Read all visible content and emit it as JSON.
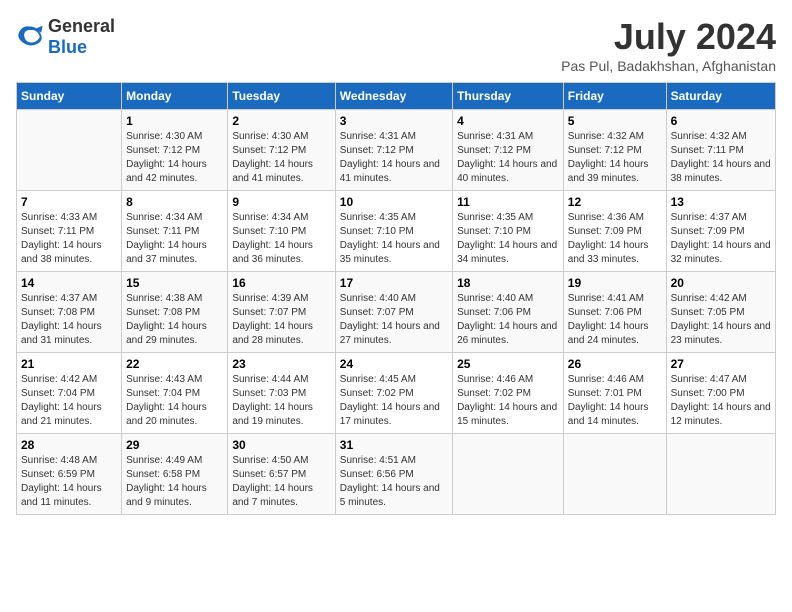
{
  "logo": {
    "general": "General",
    "blue": "Blue"
  },
  "title": "July 2024",
  "subtitle": "Pas Pul, Badakhshan, Afghanistan",
  "days_of_week": [
    "Sunday",
    "Monday",
    "Tuesday",
    "Wednesday",
    "Thursday",
    "Friday",
    "Saturday"
  ],
  "weeks": [
    [
      {
        "day": "",
        "sunrise": "",
        "sunset": "",
        "daylight": ""
      },
      {
        "day": "1",
        "sunrise": "Sunrise: 4:30 AM",
        "sunset": "Sunset: 7:12 PM",
        "daylight": "Daylight: 14 hours and 42 minutes."
      },
      {
        "day": "2",
        "sunrise": "Sunrise: 4:30 AM",
        "sunset": "Sunset: 7:12 PM",
        "daylight": "Daylight: 14 hours and 41 minutes."
      },
      {
        "day": "3",
        "sunrise": "Sunrise: 4:31 AM",
        "sunset": "Sunset: 7:12 PM",
        "daylight": "Daylight: 14 hours and 41 minutes."
      },
      {
        "day": "4",
        "sunrise": "Sunrise: 4:31 AM",
        "sunset": "Sunset: 7:12 PM",
        "daylight": "Daylight: 14 hours and 40 minutes."
      },
      {
        "day": "5",
        "sunrise": "Sunrise: 4:32 AM",
        "sunset": "Sunset: 7:12 PM",
        "daylight": "Daylight: 14 hours and 39 minutes."
      },
      {
        "day": "6",
        "sunrise": "Sunrise: 4:32 AM",
        "sunset": "Sunset: 7:11 PM",
        "daylight": "Daylight: 14 hours and 38 minutes."
      }
    ],
    [
      {
        "day": "7",
        "sunrise": "Sunrise: 4:33 AM",
        "sunset": "Sunset: 7:11 PM",
        "daylight": "Daylight: 14 hours and 38 minutes."
      },
      {
        "day": "8",
        "sunrise": "Sunrise: 4:34 AM",
        "sunset": "Sunset: 7:11 PM",
        "daylight": "Daylight: 14 hours and 37 minutes."
      },
      {
        "day": "9",
        "sunrise": "Sunrise: 4:34 AM",
        "sunset": "Sunset: 7:10 PM",
        "daylight": "Daylight: 14 hours and 36 minutes."
      },
      {
        "day": "10",
        "sunrise": "Sunrise: 4:35 AM",
        "sunset": "Sunset: 7:10 PM",
        "daylight": "Daylight: 14 hours and 35 minutes."
      },
      {
        "day": "11",
        "sunrise": "Sunrise: 4:35 AM",
        "sunset": "Sunset: 7:10 PM",
        "daylight": "Daylight: 14 hours and 34 minutes."
      },
      {
        "day": "12",
        "sunrise": "Sunrise: 4:36 AM",
        "sunset": "Sunset: 7:09 PM",
        "daylight": "Daylight: 14 hours and 33 minutes."
      },
      {
        "day": "13",
        "sunrise": "Sunrise: 4:37 AM",
        "sunset": "Sunset: 7:09 PM",
        "daylight": "Daylight: 14 hours and 32 minutes."
      }
    ],
    [
      {
        "day": "14",
        "sunrise": "Sunrise: 4:37 AM",
        "sunset": "Sunset: 7:08 PM",
        "daylight": "Daylight: 14 hours and 31 minutes."
      },
      {
        "day": "15",
        "sunrise": "Sunrise: 4:38 AM",
        "sunset": "Sunset: 7:08 PM",
        "daylight": "Daylight: 14 hours and 29 minutes."
      },
      {
        "day": "16",
        "sunrise": "Sunrise: 4:39 AM",
        "sunset": "Sunset: 7:07 PM",
        "daylight": "Daylight: 14 hours and 28 minutes."
      },
      {
        "day": "17",
        "sunrise": "Sunrise: 4:40 AM",
        "sunset": "Sunset: 7:07 PM",
        "daylight": "Daylight: 14 hours and 27 minutes."
      },
      {
        "day": "18",
        "sunrise": "Sunrise: 4:40 AM",
        "sunset": "Sunset: 7:06 PM",
        "daylight": "Daylight: 14 hours and 26 minutes."
      },
      {
        "day": "19",
        "sunrise": "Sunrise: 4:41 AM",
        "sunset": "Sunset: 7:06 PM",
        "daylight": "Daylight: 14 hours and 24 minutes."
      },
      {
        "day": "20",
        "sunrise": "Sunrise: 4:42 AM",
        "sunset": "Sunset: 7:05 PM",
        "daylight": "Daylight: 14 hours and 23 minutes."
      }
    ],
    [
      {
        "day": "21",
        "sunrise": "Sunrise: 4:42 AM",
        "sunset": "Sunset: 7:04 PM",
        "daylight": "Daylight: 14 hours and 21 minutes."
      },
      {
        "day": "22",
        "sunrise": "Sunrise: 4:43 AM",
        "sunset": "Sunset: 7:04 PM",
        "daylight": "Daylight: 14 hours and 20 minutes."
      },
      {
        "day": "23",
        "sunrise": "Sunrise: 4:44 AM",
        "sunset": "Sunset: 7:03 PM",
        "daylight": "Daylight: 14 hours and 19 minutes."
      },
      {
        "day": "24",
        "sunrise": "Sunrise: 4:45 AM",
        "sunset": "Sunset: 7:02 PM",
        "daylight": "Daylight: 14 hours and 17 minutes."
      },
      {
        "day": "25",
        "sunrise": "Sunrise: 4:46 AM",
        "sunset": "Sunset: 7:02 PM",
        "daylight": "Daylight: 14 hours and 15 minutes."
      },
      {
        "day": "26",
        "sunrise": "Sunrise: 4:46 AM",
        "sunset": "Sunset: 7:01 PM",
        "daylight": "Daylight: 14 hours and 14 minutes."
      },
      {
        "day": "27",
        "sunrise": "Sunrise: 4:47 AM",
        "sunset": "Sunset: 7:00 PM",
        "daylight": "Daylight: 14 hours and 12 minutes."
      }
    ],
    [
      {
        "day": "28",
        "sunrise": "Sunrise: 4:48 AM",
        "sunset": "Sunset: 6:59 PM",
        "daylight": "Daylight: 14 hours and 11 minutes."
      },
      {
        "day": "29",
        "sunrise": "Sunrise: 4:49 AM",
        "sunset": "Sunset: 6:58 PM",
        "daylight": "Daylight: 14 hours and 9 minutes."
      },
      {
        "day": "30",
        "sunrise": "Sunrise: 4:50 AM",
        "sunset": "Sunset: 6:57 PM",
        "daylight": "Daylight: 14 hours and 7 minutes."
      },
      {
        "day": "31",
        "sunrise": "Sunrise: 4:51 AM",
        "sunset": "Sunset: 6:56 PM",
        "daylight": "Daylight: 14 hours and 5 minutes."
      },
      {
        "day": "",
        "sunrise": "",
        "sunset": "",
        "daylight": ""
      },
      {
        "day": "",
        "sunrise": "",
        "sunset": "",
        "daylight": ""
      },
      {
        "day": "",
        "sunrise": "",
        "sunset": "",
        "daylight": ""
      }
    ]
  ]
}
